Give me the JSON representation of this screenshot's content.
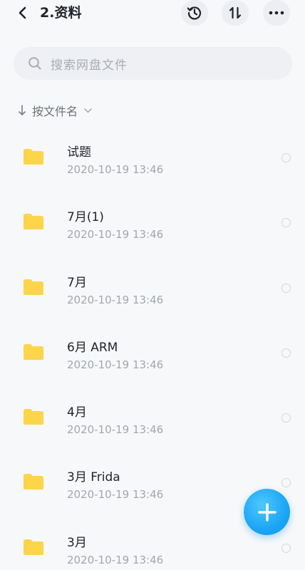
{
  "header": {
    "title": "2.资料",
    "icons": {
      "back": "back-arrow-icon",
      "history": "history-icon",
      "sort": "sort-icon",
      "more": "more-icon"
    }
  },
  "search": {
    "placeholder": "搜索网盘文件",
    "icon": "search-icon"
  },
  "sort": {
    "label": "按文件名",
    "icon": "arrow-down-icon"
  },
  "files": [
    {
      "name": "试题",
      "time": "2020-10-19  13:46"
    },
    {
      "name": "7月(1)",
      "time": "2020-10-19  13:46"
    },
    {
      "name": "7月",
      "time": "2020-10-19  13:46"
    },
    {
      "name": "6月 ARM",
      "time": "2020-10-19  13:46"
    },
    {
      "name": "4月",
      "time": "2020-10-19  13:46"
    },
    {
      "name": "3月 Frida",
      "time": "2020-10-19  13:46"
    },
    {
      "name": "3月",
      "time": "2020-10-19  13:46"
    }
  ],
  "colors": {
    "accent": "#1aa6f5",
    "folder": "#fdd54a",
    "background": "#f7f8fa"
  },
  "fab": {
    "icon": "plus-icon"
  }
}
